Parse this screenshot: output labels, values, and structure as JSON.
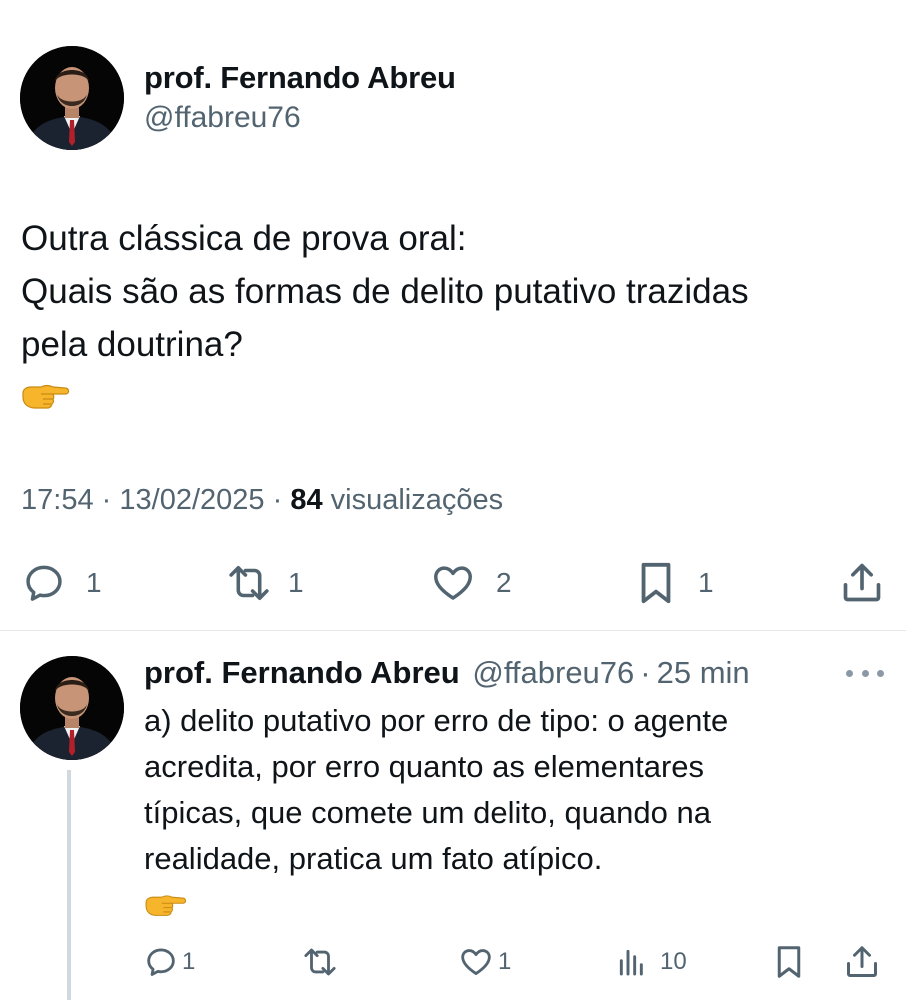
{
  "tweet": {
    "author_name": "prof. Fernando Abreu",
    "author_handle": "@ffabreu76",
    "text_lines": [
      "Outra clássica de prova oral:",
      "Quais são as formas de delito putativo trazidas",
      "pela doutrina?"
    ],
    "emoji": "👉",
    "time": "17:54",
    "date": "13/02/2025",
    "separator": "·",
    "views_count": "84",
    "views_label": "visualizações",
    "actions": {
      "reply_count": "1",
      "retweet_count": "1",
      "like_count": "2",
      "bookmark_count": "1"
    }
  },
  "reply": {
    "author_name": "prof. Fernando Abreu",
    "author_handle": "@ffabreu76",
    "separator": "·",
    "time_ago": "25 min",
    "text_lines": [
      "a) delito putativo por erro de tipo: o agente",
      "acredita, por erro quanto as elementares",
      "típicas, que comete um delito, quando na",
      "realidade, pratica um fato atípico."
    ],
    "emoji": "👉",
    "actions": {
      "reply_count": "1",
      "like_count": "1",
      "views_count": "10"
    }
  },
  "icons": {
    "reply": "speech-bubble-icon",
    "retweet": "retweet-arrows-icon",
    "like": "heart-icon",
    "bookmark": "bookmark-icon",
    "share": "share-upload-icon",
    "views": "bar-chart-icon",
    "more": "more-dots-icon"
  },
  "colors": {
    "text": "#0f1419",
    "secondary": "#536471",
    "divider": "#e6e9ec",
    "thread_line": "#cfd9de"
  }
}
